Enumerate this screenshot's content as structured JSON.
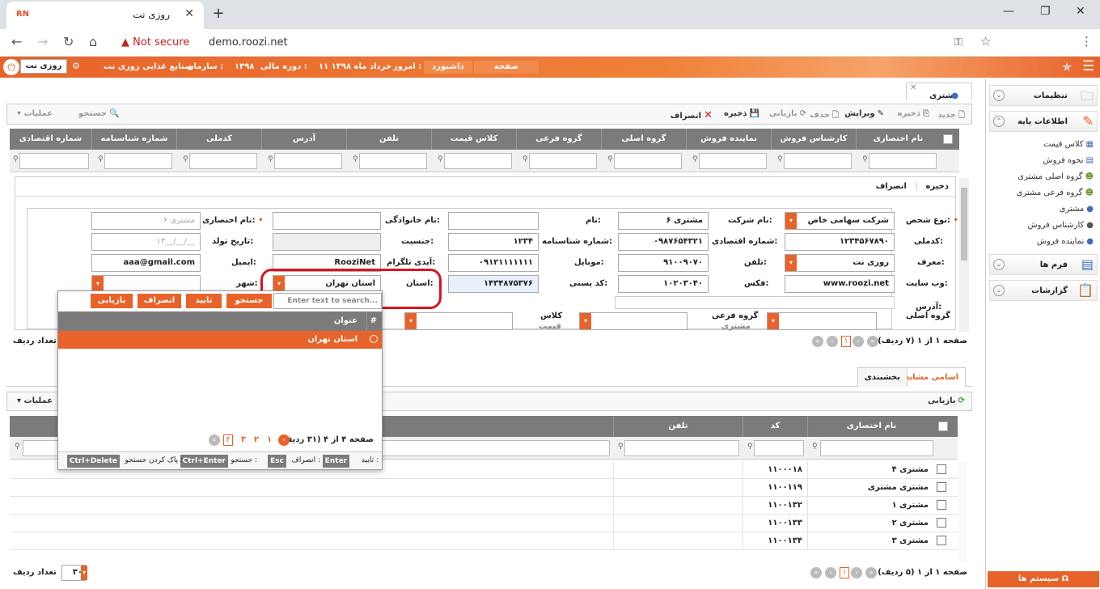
{
  "browser": {
    "tab_title": "روزی نت",
    "favicon_text": "RN",
    "not_secure": "Not secure",
    "url": "demo.roozi.net"
  },
  "header": {
    "user_box": "روزی نت",
    "organization_label": "سازمان :",
    "organization_value": "صنایع غذایی روزی نت",
    "fiscal_label": "دوره مالی :",
    "fiscal_value": "۱۳۹۸",
    "today_label": "امروز :",
    "today_value": "۱۱ خرداد ماه ۱۳۹۸",
    "dashboard_button": "داشبورد",
    "home_button": "صفحه نخست"
  },
  "sidebar": {
    "settings": "تنظیمات",
    "base_info": "اطلاعات پایه",
    "items": [
      {
        "label": "کلاس قیمت",
        "icon": "grid-icon"
      },
      {
        "label": "نحوه فروش",
        "icon": "doc-icon"
      },
      {
        "label": "گروه اصلی مشتری",
        "icon": "users-icon"
      },
      {
        "label": "گروه فرعی مشتری",
        "icon": "users-icon"
      },
      {
        "label": "مشتری",
        "icon": "user-icon"
      },
      {
        "label": "کارشناس فروش",
        "icon": "user-icon"
      },
      {
        "label": "نماینده فروش",
        "icon": "user-icon"
      }
    ],
    "forms": "فرم ها",
    "reports": "گزارشات",
    "system_footer": "سیستم ها"
  },
  "doc_tab": "مشتری",
  "toolbar": {
    "new": "جدید",
    "save": "ذخیره",
    "edit": "ویرایش",
    "delete": "حذف",
    "refresh": "بازیابی",
    "save2": "ذخیره",
    "cancel": "انصراف",
    "search": "جستجو",
    "operations": "عملیات"
  },
  "grid": {
    "columns": [
      "نام اختصاری",
      "کارشناس فروش",
      "نماینده فروش",
      "گروه اصلی",
      "گروه فرعی",
      "کلاس قیمت",
      "تلفن",
      "آدرس",
      "کدملی",
      "شماره شناسنامه",
      "شماره اقتصادی"
    ]
  },
  "form": {
    "save": "ذخیره",
    "cancel": "انصراف",
    "person_type_label": "نوع شخص:",
    "person_type": "شرکت سهامی خاص",
    "company_name_label": "نام شرکت:",
    "company_name": "مشتری ۶",
    "first_name_label": "نام:",
    "first_name": "",
    "last_name_label": "نام خانوادگی:",
    "last_name": "",
    "short_name_label": "نام اختصاری:",
    "short_name": "مشتری ۶",
    "national_code_label": "کدملی:",
    "national_code": "۱۲۳۴۵۶۷۸۹۰",
    "economic_no_label": "شماره اقتصادی:",
    "economic_no": "۰۹۸۷۶۵۴۳۲۱",
    "id_no_label": "شماره شناسنامه:",
    "id_no": "۱۲۳۴",
    "gender_label": "جنسیت:",
    "gender": "",
    "birth_label": "تاریخ تولد:",
    "birth_placeholder": "۱۳__/__/__",
    "referrer_label": "معرف:",
    "referrer": "روزی نت",
    "phone_label": "تلفن:",
    "phone": "۹۱۰۰۹۰۷۰",
    "mobile_label": "موبایل:",
    "mobile": "۰۹۱۲۱۱۱۱۱۱۱",
    "telegram_label": "آیدی تلگرام:",
    "telegram": "RooziNet",
    "email_label": "ایمیل:",
    "email": "aaa@gmail.com",
    "website_label": "وب سایت:",
    "website": "www.roozi.net",
    "fax_label": "فکس:",
    "fax": "۱۰۲۰۳۰۴۰",
    "postal_label": "کد پستی:",
    "postal": "۱۴۳۴۸۷۵۳۷۶",
    "province_label": "استان:",
    "province": "استان تهران",
    "city_label": "شهر:",
    "address_label": "آدرس:",
    "main_group_label": "گروه اصلی",
    "sub_group_label": "گروه فرعی",
    "sub_group_extra": "مشتری",
    "class_label": "کلاس",
    "class_extra": "قیمت"
  },
  "pager1": {
    "text": "صفحه ۱ از ۱ (۷ ردیف)",
    "page": "۱",
    "rows_label": "تعداد ردیف"
  },
  "lower": {
    "tab_similar": "اسامی مشابه",
    "tab_division": "بخشبندی",
    "refresh": "بازیابی",
    "operations": "عملیات",
    "columns": [
      "نام اختصاری",
      "کد",
      "تلفن"
    ],
    "rows": [
      {
        "name": "مشتری ۴",
        "code": "۱۱۰۰۰۱۸"
      },
      {
        "name": "مشتری مشتری",
        "code": "۱۱۰۰۱۱۹"
      },
      {
        "name": "مشتری ۱",
        "code": "۱۱۰۰۱۳۲"
      },
      {
        "name": "مشتری ۲",
        "code": "۱۱۰۰۱۳۳"
      },
      {
        "name": "مشتری ۳",
        "code": "۱۱۰۰۱۳۴"
      }
    ],
    "pager_text": "صفحه ۱ از ۱ (۵ ردیف)",
    "page": "۱",
    "rows_count": "۳۰",
    "rows_label": "تعداد ردیف"
  },
  "popup": {
    "search_placeholder": "Enter text to search...",
    "btn_search": "جستجو",
    "btn_confirm": "تایید",
    "btn_cancel": "انصراف",
    "btn_refresh": "بازیابی",
    "col_hash": "#",
    "col_title": "عنوان",
    "selected_row": "استان تهران",
    "pager_text": "صفحه ۴ از ۴ (۳۱ ردیف)",
    "pages": [
      "۱",
      "۲",
      "۳",
      "۴"
    ],
    "hints": [
      {
        "key": "Enter",
        "text": "تایید :"
      },
      {
        "key": "Esc",
        "text": "انصراف :"
      },
      {
        "key": "Ctrl+Enter",
        "text": "جستجو :"
      },
      {
        "key": "Ctrl+Delete",
        "text": "پاک کردن جستجو :"
      }
    ]
  },
  "colors": {
    "accent": "#e8632a",
    "grid_header": "#7b7b7b",
    "highlight": "#d8151f"
  }
}
